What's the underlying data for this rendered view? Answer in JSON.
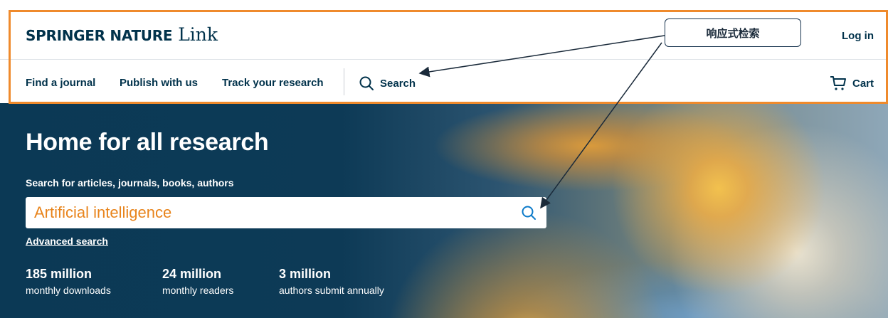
{
  "header": {
    "logo_brand": "SPRINGER NATURE",
    "logo_product": "Link",
    "login_label": "Log in",
    "nav": [
      {
        "label": "Find a journal"
      },
      {
        "label": "Publish with us"
      },
      {
        "label": "Track your research"
      }
    ],
    "search_label": "Search",
    "cart_label": "Cart"
  },
  "hero": {
    "title": "Home for all research",
    "search_label": "Search for articles, journals, books, authors",
    "search_value": "Artificial intelligence",
    "advanced_search_label": "Advanced search",
    "stats": [
      {
        "number": "185 million",
        "desc": "monthly downloads"
      },
      {
        "number": "24 million",
        "desc": "monthly readers"
      },
      {
        "number": "3 million",
        "desc": "authors submit annually"
      }
    ]
  },
  "annotation": {
    "callout_text": "响应式检索",
    "highlight_color": "#ef8a2c"
  },
  "colors": {
    "brand_navy": "#01324b",
    "search_text": "#e8841c",
    "search_icon": "#0c7ac9"
  }
}
